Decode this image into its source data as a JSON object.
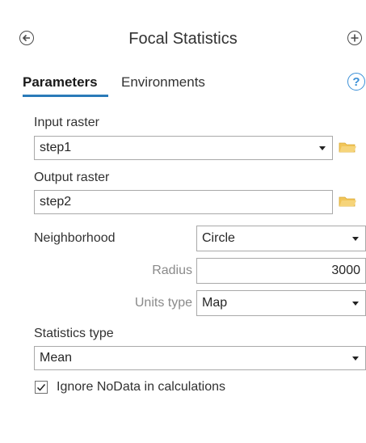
{
  "header": {
    "title": "Focal Statistics",
    "back_icon": "circle-arrow-left-icon",
    "add_icon": "circle-plus-icon"
  },
  "tabs": [
    {
      "label": "Parameters",
      "active": true
    },
    {
      "label": "Environments",
      "active": false
    }
  ],
  "help": {
    "glyph": "?",
    "icon": "help-icon"
  },
  "params": {
    "input_raster": {
      "label": "Input raster",
      "value": "step1"
    },
    "output_raster": {
      "label": "Output raster",
      "value": "step2"
    },
    "neighborhood": {
      "label": "Neighborhood",
      "value": "Circle"
    },
    "radius": {
      "label": "Radius",
      "value": "3000"
    },
    "units_type": {
      "label": "Units type",
      "value": "Map"
    },
    "statistics_type": {
      "label": "Statistics type",
      "value": "Mean"
    },
    "ignore_nodata": {
      "label": "Ignore NoData in calculations",
      "checked": true
    }
  },
  "colors": {
    "accent": "#2a7ab8",
    "help": "#3b8fd6",
    "folder": "#f2c65a"
  }
}
